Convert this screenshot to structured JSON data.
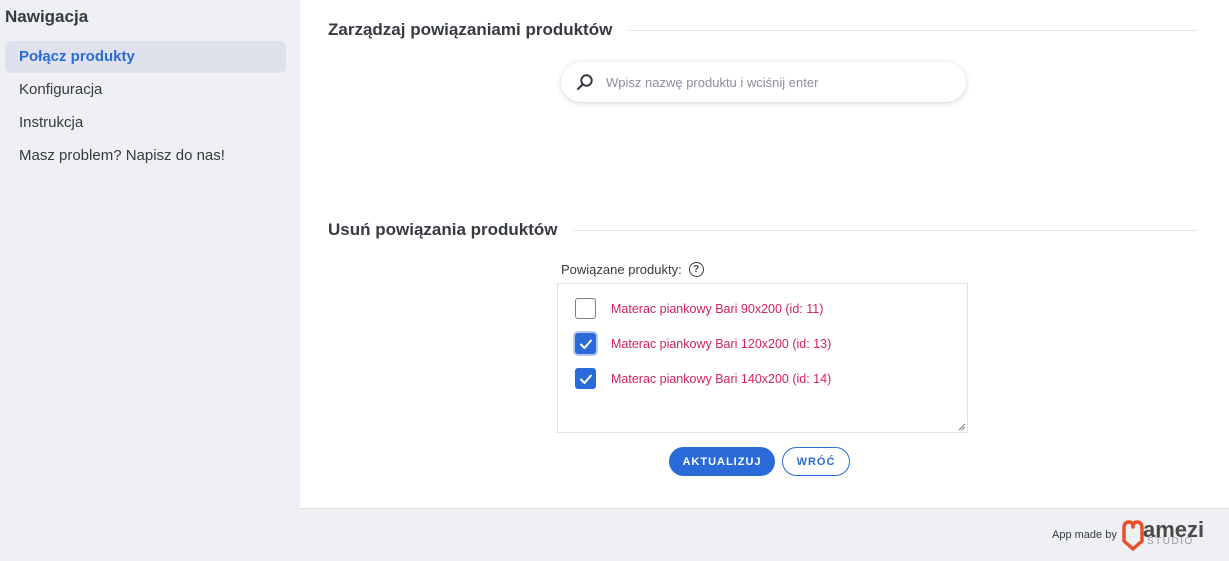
{
  "sidebar": {
    "title": "Nawigacja",
    "items": [
      {
        "label": "Połącz produkty",
        "active": true
      },
      {
        "label": "Konfiguracja",
        "active": false
      },
      {
        "label": "Instrukcja",
        "active": false
      },
      {
        "label": "Masz problem? Napisz do nas!",
        "active": false
      }
    ]
  },
  "manage_section": {
    "title": "Zarządzaj powiązaniami produktów",
    "search_placeholder": "Wpisz nazwę produktu i wciśnij enter",
    "search_value": ""
  },
  "remove_section": {
    "title": "Usuń powiązania produktów",
    "field_label": "Powiązane produkty:",
    "help_icon": "?",
    "items": [
      {
        "label": "Materac piankowy Bari 90x200 (id: 11)",
        "checked": false
      },
      {
        "label": "Materac piankowy Bari 120x200 (id: 13)",
        "checked": true
      },
      {
        "label": "Materac piankowy Bari 140x200 (id: 14)",
        "checked": true
      }
    ],
    "update_button": "AKTUALIZUJ",
    "back_button": "WRÓĆ"
  },
  "footer": {
    "made_by": "App made by",
    "brand_name": "amezi",
    "brand_sub": "STUDIO"
  },
  "colors": {
    "accent": "#2b6bd9",
    "item_text": "#d0235a",
    "brand_mark": "#e8502a"
  }
}
